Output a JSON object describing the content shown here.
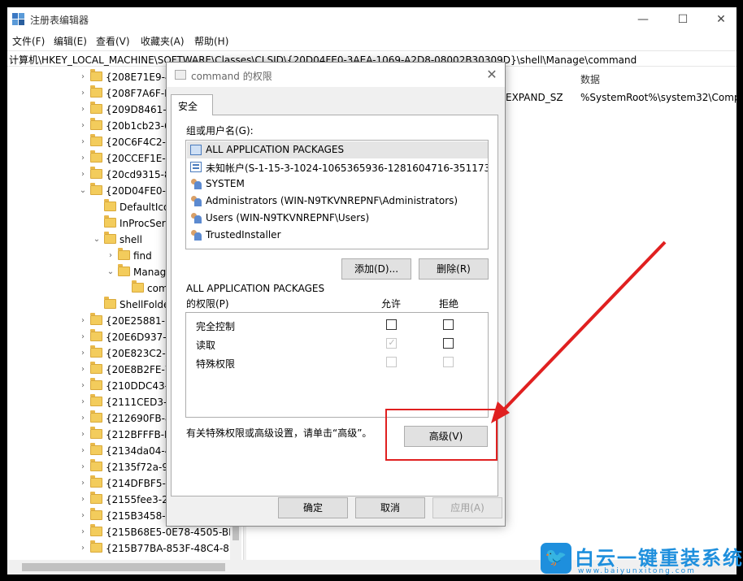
{
  "window": {
    "title": "注册表编辑器",
    "minimize": "—",
    "maximize": "☐",
    "close": "✕"
  },
  "menu": [
    "文件(F)",
    "编辑(E)",
    "查看(V)",
    "收藏夹(A)",
    "帮助(H)"
  ],
  "address": "计算机\\HKEY_LOCAL_MACHINE\\SOFTWARE\\Classes\\CLSID\\{20D04FE0-3AEA-1069-A2D8-08002B30309D}\\shell\\Manage\\command",
  "tree": [
    {
      "label": "{208E71E9-4",
      "indent": 0,
      "exp": "›"
    },
    {
      "label": "{208F7A6F-F",
      "indent": 0,
      "exp": "›"
    },
    {
      "label": "{209D8461-E",
      "indent": 0,
      "exp": "›"
    },
    {
      "label": "{20b1cb23-6",
      "indent": 0,
      "exp": "›"
    },
    {
      "label": "{20C6F4C2-8",
      "indent": 0,
      "exp": "›"
    },
    {
      "label": "{20CCEF1E-0",
      "indent": 0,
      "exp": "›"
    },
    {
      "label": "{20cd9315-8",
      "indent": 0,
      "exp": "›"
    },
    {
      "label": "{20D04FE0-3",
      "indent": 0,
      "exp": "⌄"
    },
    {
      "label": "DefaultIco",
      "indent": 1,
      "exp": ""
    },
    {
      "label": "InProcServ",
      "indent": 1,
      "exp": ""
    },
    {
      "label": "shell",
      "indent": 1,
      "exp": "⌄"
    },
    {
      "label": "find",
      "indent": 2,
      "exp": "›"
    },
    {
      "label": "Manag",
      "indent": 2,
      "exp": "⌄"
    },
    {
      "label": "com",
      "indent": 3,
      "exp": ""
    },
    {
      "label": "ShellFolde",
      "indent": 1,
      "exp": ""
    },
    {
      "label": "{20E25881-F",
      "indent": 0,
      "exp": "›"
    },
    {
      "label": "{20E6D937-F",
      "indent": 0,
      "exp": "›"
    },
    {
      "label": "{20E823C2-6",
      "indent": 0,
      "exp": "›"
    },
    {
      "label": "{20E8B2FE-7",
      "indent": 0,
      "exp": "›"
    },
    {
      "label": "{210DDC43-6",
      "indent": 0,
      "exp": "›"
    },
    {
      "label": "{2111CED3-4",
      "indent": 0,
      "exp": "›"
    },
    {
      "label": "{212690FB-8",
      "indent": 0,
      "exp": "›"
    },
    {
      "label": "{212BFFFB-D",
      "indent": 0,
      "exp": "›"
    },
    {
      "label": "{2134da04-4",
      "indent": 0,
      "exp": "›"
    },
    {
      "label": "{2135f72a-90",
      "indent": 0,
      "exp": "›"
    },
    {
      "label": "{214DFBF5-5",
      "indent": 0,
      "exp": "›"
    },
    {
      "label": "{2155fee3-24",
      "indent": 0,
      "exp": "›"
    },
    {
      "label": "{215B3458-6",
      "indent": 0,
      "exp": "›"
    },
    {
      "label": "{215B68E5-0E78-4505-BE4",
      "indent": 0,
      "exp": "›"
    },
    {
      "label": "{215B77BA-853F-48C4-8D",
      "indent": 0,
      "exp": "›"
    }
  ],
  "values_pane": {
    "col_data": "数据",
    "type": "EXPAND_SZ",
    "data": "%SystemRoot%\\system32\\Comp"
  },
  "dialog": {
    "title": "command 的权限",
    "close": "✕",
    "tab": "安全",
    "group_label": "组或用户名(G):",
    "users": [
      {
        "name": "ALL APPLICATION PACKAGES",
        "icon": "pkg"
      },
      {
        "name": "未知帐户(S-1-15-3-1024-1065365936-1281604716-351173...",
        "icon": "unk"
      },
      {
        "name": "SYSTEM",
        "icon": "grp"
      },
      {
        "name": "Administrators (WIN-N9TKVNREPNF\\Administrators)",
        "icon": "grp"
      },
      {
        "name": "Users (WIN-N9TKVNREPNF\\Users)",
        "icon": "grp"
      },
      {
        "name": "TrustedInstaller",
        "icon": "grp"
      }
    ],
    "add_button": "添加(D)...",
    "remove_button": "删除(R)",
    "perm_for": "ALL APPLICATION PACKAGES",
    "perm_label": "的权限(P)",
    "allow_col": "允许",
    "deny_col": "拒绝",
    "permissions": [
      {
        "name": "完全控制",
        "allow": "unchecked",
        "deny": "unchecked"
      },
      {
        "name": "读取",
        "allow": "checked-disabled",
        "deny": "unchecked"
      },
      {
        "name": "特殊权限",
        "allow": "disabled",
        "deny": "disabled"
      }
    ],
    "advanced_hint": "有关特殊权限或高级设置，请单击“高级”。",
    "advanced_button": "高级(V)",
    "ok_button": "确定",
    "cancel_button": "取消",
    "apply_button": "应用(A)"
  },
  "annotation_color": "#e02020",
  "watermark": {
    "text": "白云一键重装系统",
    "url": "www.baiyunxitong.com",
    "icon": "twitter-bird-icon",
    "color": "#1e8fdd"
  }
}
